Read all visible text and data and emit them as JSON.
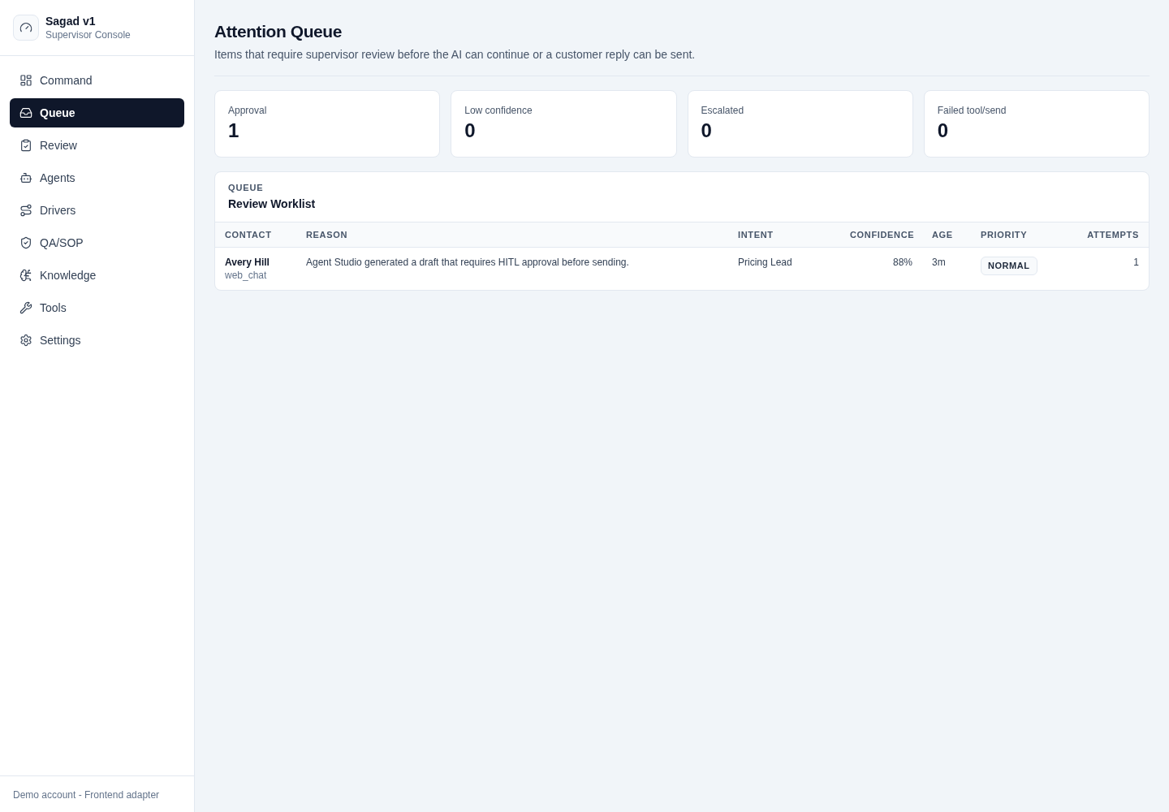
{
  "sidebar": {
    "brand": {
      "title": "Sagad v1",
      "subtitle": "Supervisor Console"
    },
    "nav": [
      {
        "label": "Command",
        "selected": false
      },
      {
        "label": "Queue",
        "selected": true
      },
      {
        "label": "Review",
        "selected": false
      },
      {
        "label": "Agents",
        "selected": false
      },
      {
        "label": "Drivers",
        "selected": false
      },
      {
        "label": "QA/SOP",
        "selected": false
      },
      {
        "label": "Knowledge",
        "selected": false
      },
      {
        "label": "Tools",
        "selected": false
      },
      {
        "label": "Settings",
        "selected": false
      }
    ],
    "footer": "Demo account - Frontend adapter"
  },
  "header": {
    "title": "Attention Queue",
    "subtitle": "Items that require supervisor review before the AI can continue or a customer reply can be sent."
  },
  "stats": [
    {
      "label": "Approval",
      "value": "1"
    },
    {
      "label": "Low confidence",
      "value": "0"
    },
    {
      "label": "Escalated",
      "value": "0"
    },
    {
      "label": "Failed tool/send",
      "value": "0"
    }
  ],
  "worklist": {
    "eyebrow": "QUEUE",
    "title": "Review Worklist",
    "table": {
      "columns": [
        "CONTACT",
        "REASON",
        "INTENT",
        "CONFIDENCE",
        "AGE",
        "PRIORITY",
        "ATTEMPTS"
      ],
      "rows": [
        {
          "contact": {
            "name": "Avery Hill",
            "channel": "web_chat"
          },
          "reason": "Agent Studio generated a draft that requires HITL approval before sending.",
          "intent": "Pricing Lead",
          "confidence": "88%",
          "age": "3m",
          "priority": "NORMAL",
          "attempts": "1"
        }
      ]
    }
  }
}
